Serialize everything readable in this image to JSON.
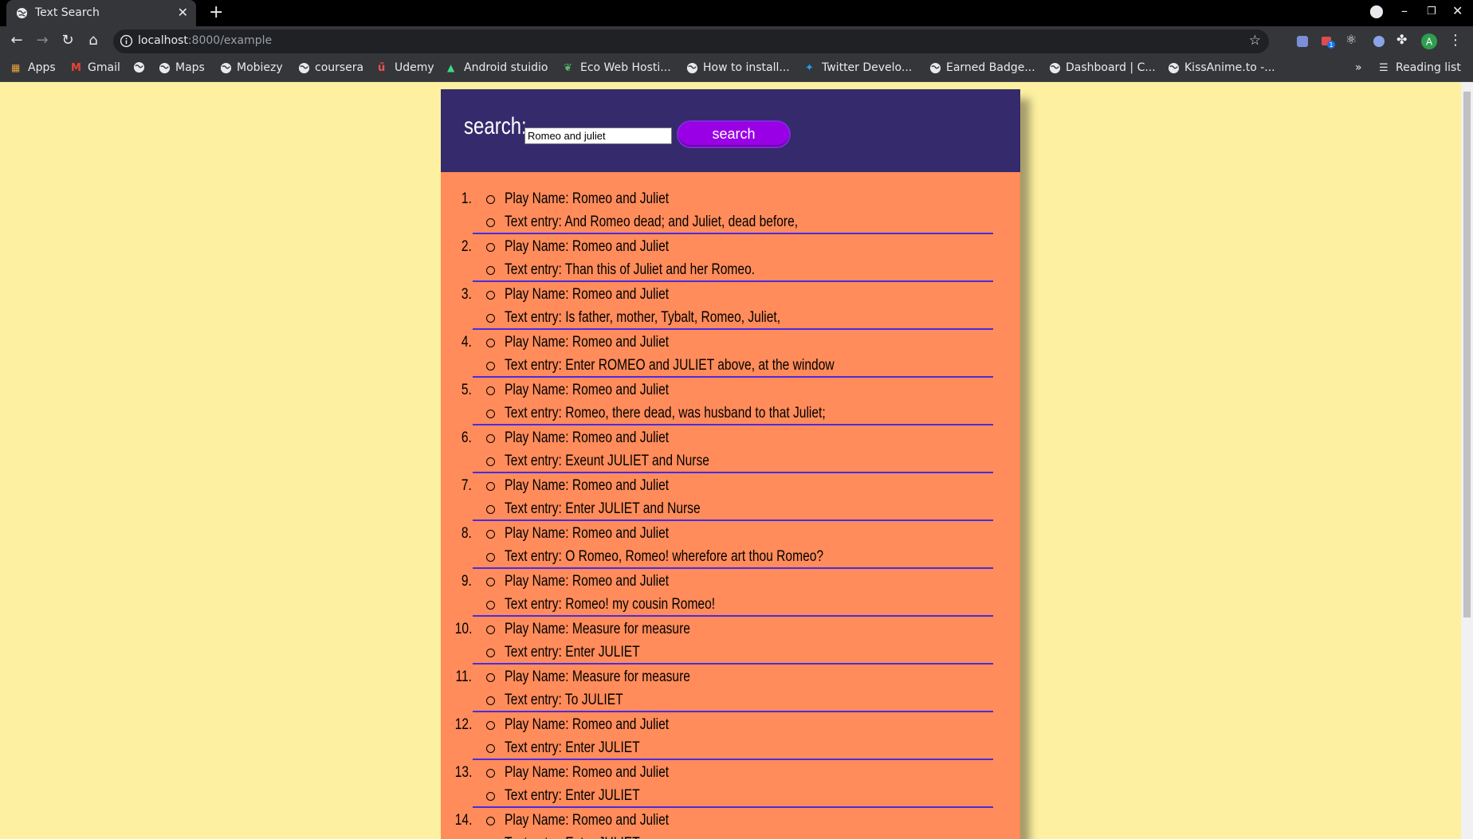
{
  "browser": {
    "tab_title": "Text Search",
    "url_host": "localhost",
    "url_path": ":8000/example",
    "reading_list": "Reading list",
    "profile_initial": "A",
    "extension_badge": "1",
    "bookmarks": [
      "Apps",
      "Gmail",
      "",
      "Maps",
      "Mobiezy",
      "coursera",
      "Udemy",
      "Android stuidio",
      "Eco Web Hosti...",
      "How to install...",
      "Twitter Develo...",
      "Earned Badge...",
      "Dashboard | C...",
      "KissAnime.to -..."
    ]
  },
  "search": {
    "label": "search:",
    "value": "Romeo and juliet",
    "button": "search"
  },
  "results": [
    {
      "num": "1.",
      "play": "Play Name: Romeo and Juliet",
      "text": "Text entry: And Romeo dead; and Juliet, dead before,"
    },
    {
      "num": "2.",
      "play": "Play Name: Romeo and Juliet",
      "text": "Text entry: Than this of Juliet and her Romeo."
    },
    {
      "num": "3.",
      "play": "Play Name: Romeo and Juliet",
      "text": "Text entry: Is father, mother, Tybalt, Romeo, Juliet,"
    },
    {
      "num": "4.",
      "play": "Play Name: Romeo and Juliet",
      "text": "Text entry: Enter ROMEO and JULIET above, at the window"
    },
    {
      "num": "5.",
      "play": "Play Name: Romeo and Juliet",
      "text": "Text entry: Romeo, there dead, was husband to that Juliet;"
    },
    {
      "num": "6.",
      "play": "Play Name: Romeo and Juliet",
      "text": "Text entry: Exeunt JULIET and Nurse"
    },
    {
      "num": "7.",
      "play": "Play Name: Romeo and Juliet",
      "text": "Text entry: Enter JULIET and Nurse"
    },
    {
      "num": "8.",
      "play": "Play Name: Romeo and Juliet",
      "text": "Text entry: O Romeo, Romeo! wherefore art thou Romeo?"
    },
    {
      "num": "9.",
      "play": "Play Name: Romeo and Juliet",
      "text": "Text entry: Romeo! my cousin Romeo!"
    },
    {
      "num": "10.",
      "play": "Play Name: Measure for measure",
      "text": "Text entry: Enter JULIET"
    },
    {
      "num": "11.",
      "play": "Play Name: Measure for measure",
      "text": "Text entry: To JULIET"
    },
    {
      "num": "12.",
      "play": "Play Name: Romeo and Juliet",
      "text": "Text entry: Enter JULIET"
    },
    {
      "num": "13.",
      "play": "Play Name: Romeo and Juliet",
      "text": "Text entry: Enter JULIET"
    },
    {
      "num": "14.",
      "play": "Play Name: Romeo and Juliet",
      "text": "Text entry: Enter JULIET"
    }
  ],
  "colors": {
    "page_bg": "#fdf0a0",
    "header_bg": "#342a6c",
    "body_bg": "#ff8c5a",
    "button_bg": "#9a00e6",
    "rule": "#4b2be0"
  }
}
